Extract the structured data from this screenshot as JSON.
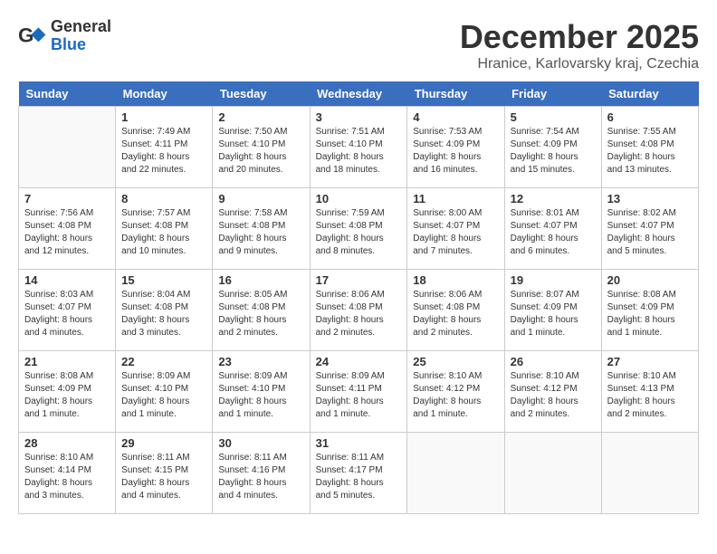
{
  "logo": {
    "general": "General",
    "blue": "Blue"
  },
  "title": "December 2025",
  "location": "Hranice, Karlovarsky kraj, Czechia",
  "weekdays": [
    "Sunday",
    "Monday",
    "Tuesday",
    "Wednesday",
    "Thursday",
    "Friday",
    "Saturday"
  ],
  "weeks": [
    [
      {
        "day": "",
        "info": ""
      },
      {
        "day": "1",
        "info": "Sunrise: 7:49 AM\nSunset: 4:11 PM\nDaylight: 8 hours\nand 22 minutes."
      },
      {
        "day": "2",
        "info": "Sunrise: 7:50 AM\nSunset: 4:10 PM\nDaylight: 8 hours\nand 20 minutes."
      },
      {
        "day": "3",
        "info": "Sunrise: 7:51 AM\nSunset: 4:10 PM\nDaylight: 8 hours\nand 18 minutes."
      },
      {
        "day": "4",
        "info": "Sunrise: 7:53 AM\nSunset: 4:09 PM\nDaylight: 8 hours\nand 16 minutes."
      },
      {
        "day": "5",
        "info": "Sunrise: 7:54 AM\nSunset: 4:09 PM\nDaylight: 8 hours\nand 15 minutes."
      },
      {
        "day": "6",
        "info": "Sunrise: 7:55 AM\nSunset: 4:08 PM\nDaylight: 8 hours\nand 13 minutes."
      }
    ],
    [
      {
        "day": "7",
        "info": "Sunrise: 7:56 AM\nSunset: 4:08 PM\nDaylight: 8 hours\nand 12 minutes."
      },
      {
        "day": "8",
        "info": "Sunrise: 7:57 AM\nSunset: 4:08 PM\nDaylight: 8 hours\nand 10 minutes."
      },
      {
        "day": "9",
        "info": "Sunrise: 7:58 AM\nSunset: 4:08 PM\nDaylight: 8 hours\nand 9 minutes."
      },
      {
        "day": "10",
        "info": "Sunrise: 7:59 AM\nSunset: 4:08 PM\nDaylight: 8 hours\nand 8 minutes."
      },
      {
        "day": "11",
        "info": "Sunrise: 8:00 AM\nSunset: 4:07 PM\nDaylight: 8 hours\nand 7 minutes."
      },
      {
        "day": "12",
        "info": "Sunrise: 8:01 AM\nSunset: 4:07 PM\nDaylight: 8 hours\nand 6 minutes."
      },
      {
        "day": "13",
        "info": "Sunrise: 8:02 AM\nSunset: 4:07 PM\nDaylight: 8 hours\nand 5 minutes."
      }
    ],
    [
      {
        "day": "14",
        "info": "Sunrise: 8:03 AM\nSunset: 4:07 PM\nDaylight: 8 hours\nand 4 minutes."
      },
      {
        "day": "15",
        "info": "Sunrise: 8:04 AM\nSunset: 4:08 PM\nDaylight: 8 hours\nand 3 minutes."
      },
      {
        "day": "16",
        "info": "Sunrise: 8:05 AM\nSunset: 4:08 PM\nDaylight: 8 hours\nand 2 minutes."
      },
      {
        "day": "17",
        "info": "Sunrise: 8:06 AM\nSunset: 4:08 PM\nDaylight: 8 hours\nand 2 minutes."
      },
      {
        "day": "18",
        "info": "Sunrise: 8:06 AM\nSunset: 4:08 PM\nDaylight: 8 hours\nand 2 minutes."
      },
      {
        "day": "19",
        "info": "Sunrise: 8:07 AM\nSunset: 4:09 PM\nDaylight: 8 hours\nand 1 minute."
      },
      {
        "day": "20",
        "info": "Sunrise: 8:08 AM\nSunset: 4:09 PM\nDaylight: 8 hours\nand 1 minute."
      }
    ],
    [
      {
        "day": "21",
        "info": "Sunrise: 8:08 AM\nSunset: 4:09 PM\nDaylight: 8 hours\nand 1 minute."
      },
      {
        "day": "22",
        "info": "Sunrise: 8:09 AM\nSunset: 4:10 PM\nDaylight: 8 hours\nand 1 minute."
      },
      {
        "day": "23",
        "info": "Sunrise: 8:09 AM\nSunset: 4:10 PM\nDaylight: 8 hours\nand 1 minute."
      },
      {
        "day": "24",
        "info": "Sunrise: 8:09 AM\nSunset: 4:11 PM\nDaylight: 8 hours\nand 1 minute."
      },
      {
        "day": "25",
        "info": "Sunrise: 8:10 AM\nSunset: 4:12 PM\nDaylight: 8 hours\nand 1 minute."
      },
      {
        "day": "26",
        "info": "Sunrise: 8:10 AM\nSunset: 4:12 PM\nDaylight: 8 hours\nand 2 minutes."
      },
      {
        "day": "27",
        "info": "Sunrise: 8:10 AM\nSunset: 4:13 PM\nDaylight: 8 hours\nand 2 minutes."
      }
    ],
    [
      {
        "day": "28",
        "info": "Sunrise: 8:10 AM\nSunset: 4:14 PM\nDaylight: 8 hours\nand 3 minutes."
      },
      {
        "day": "29",
        "info": "Sunrise: 8:11 AM\nSunset: 4:15 PM\nDaylight: 8 hours\nand 4 minutes."
      },
      {
        "day": "30",
        "info": "Sunrise: 8:11 AM\nSunset: 4:16 PM\nDaylight: 8 hours\nand 4 minutes."
      },
      {
        "day": "31",
        "info": "Sunrise: 8:11 AM\nSunset: 4:17 PM\nDaylight: 8 hours\nand 5 minutes."
      },
      {
        "day": "",
        "info": ""
      },
      {
        "day": "",
        "info": ""
      },
      {
        "day": "",
        "info": ""
      }
    ]
  ]
}
